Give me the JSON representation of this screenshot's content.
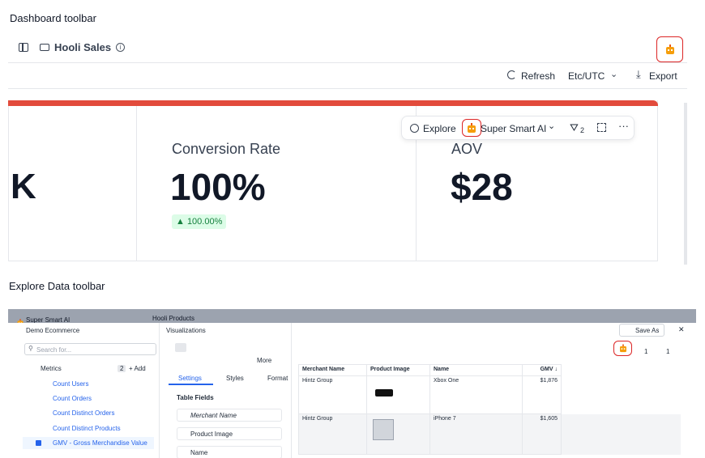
{
  "section1": {
    "label": "Dashboard toolbar"
  },
  "header": {
    "title": "Hooli Sales"
  },
  "toolbar": {
    "refresh": "Refresh",
    "timezone": "Etc/UTC",
    "export": "Export"
  },
  "cards": {
    "left_value": "K",
    "conversion": {
      "title": "Conversion Rate",
      "value": "100%",
      "delta": "▲ 100.00%"
    },
    "aov": {
      "title": "AOV",
      "value": "$28"
    }
  },
  "pill": {
    "explore": "Explore",
    "ai": "Super Smart AI",
    "filter_count": "2"
  },
  "section2": {
    "label": "Explore Data toolbar"
  },
  "explore": {
    "bg_top_left": "Super Smart AI",
    "bg_top_center": "Hooli Products",
    "dataset": "Demo Ecommerce",
    "search_placeholder": "Search for...",
    "metrics_label": "Metrics",
    "metrics_count": "2",
    "add": "+ Add",
    "metrics": [
      "Count Users",
      "Count Orders",
      "Count Distinct Orders",
      "Count Distinct Products",
      "GMV - Gross Merchandise Value"
    ],
    "viz_title": "Visualizations",
    "more": "More",
    "tabs": [
      "Settings",
      "Styles",
      "Format"
    ],
    "table_fields_label": "Table Fields",
    "fields": [
      "Merchant Name",
      "Product Image",
      "Name"
    ],
    "save_as": "Save As",
    "filter_count": "1",
    "sort_count": "1",
    "table": {
      "headers": [
        "Merchant Name",
        "Product Image",
        "Name",
        "GMV ↓"
      ],
      "rows": [
        {
          "merchant": "Hintz Group",
          "name": "Xbox One",
          "gmv": "$1,876"
        },
        {
          "merchant": "Hintz Group",
          "name": "iPhone 7",
          "gmv": "$1,605"
        }
      ]
    }
  },
  "colors": {
    "accent": "#e24b3c",
    "highlight": "#dc2626",
    "link": "#2563eb",
    "delta_bg": "#dcfce7"
  }
}
